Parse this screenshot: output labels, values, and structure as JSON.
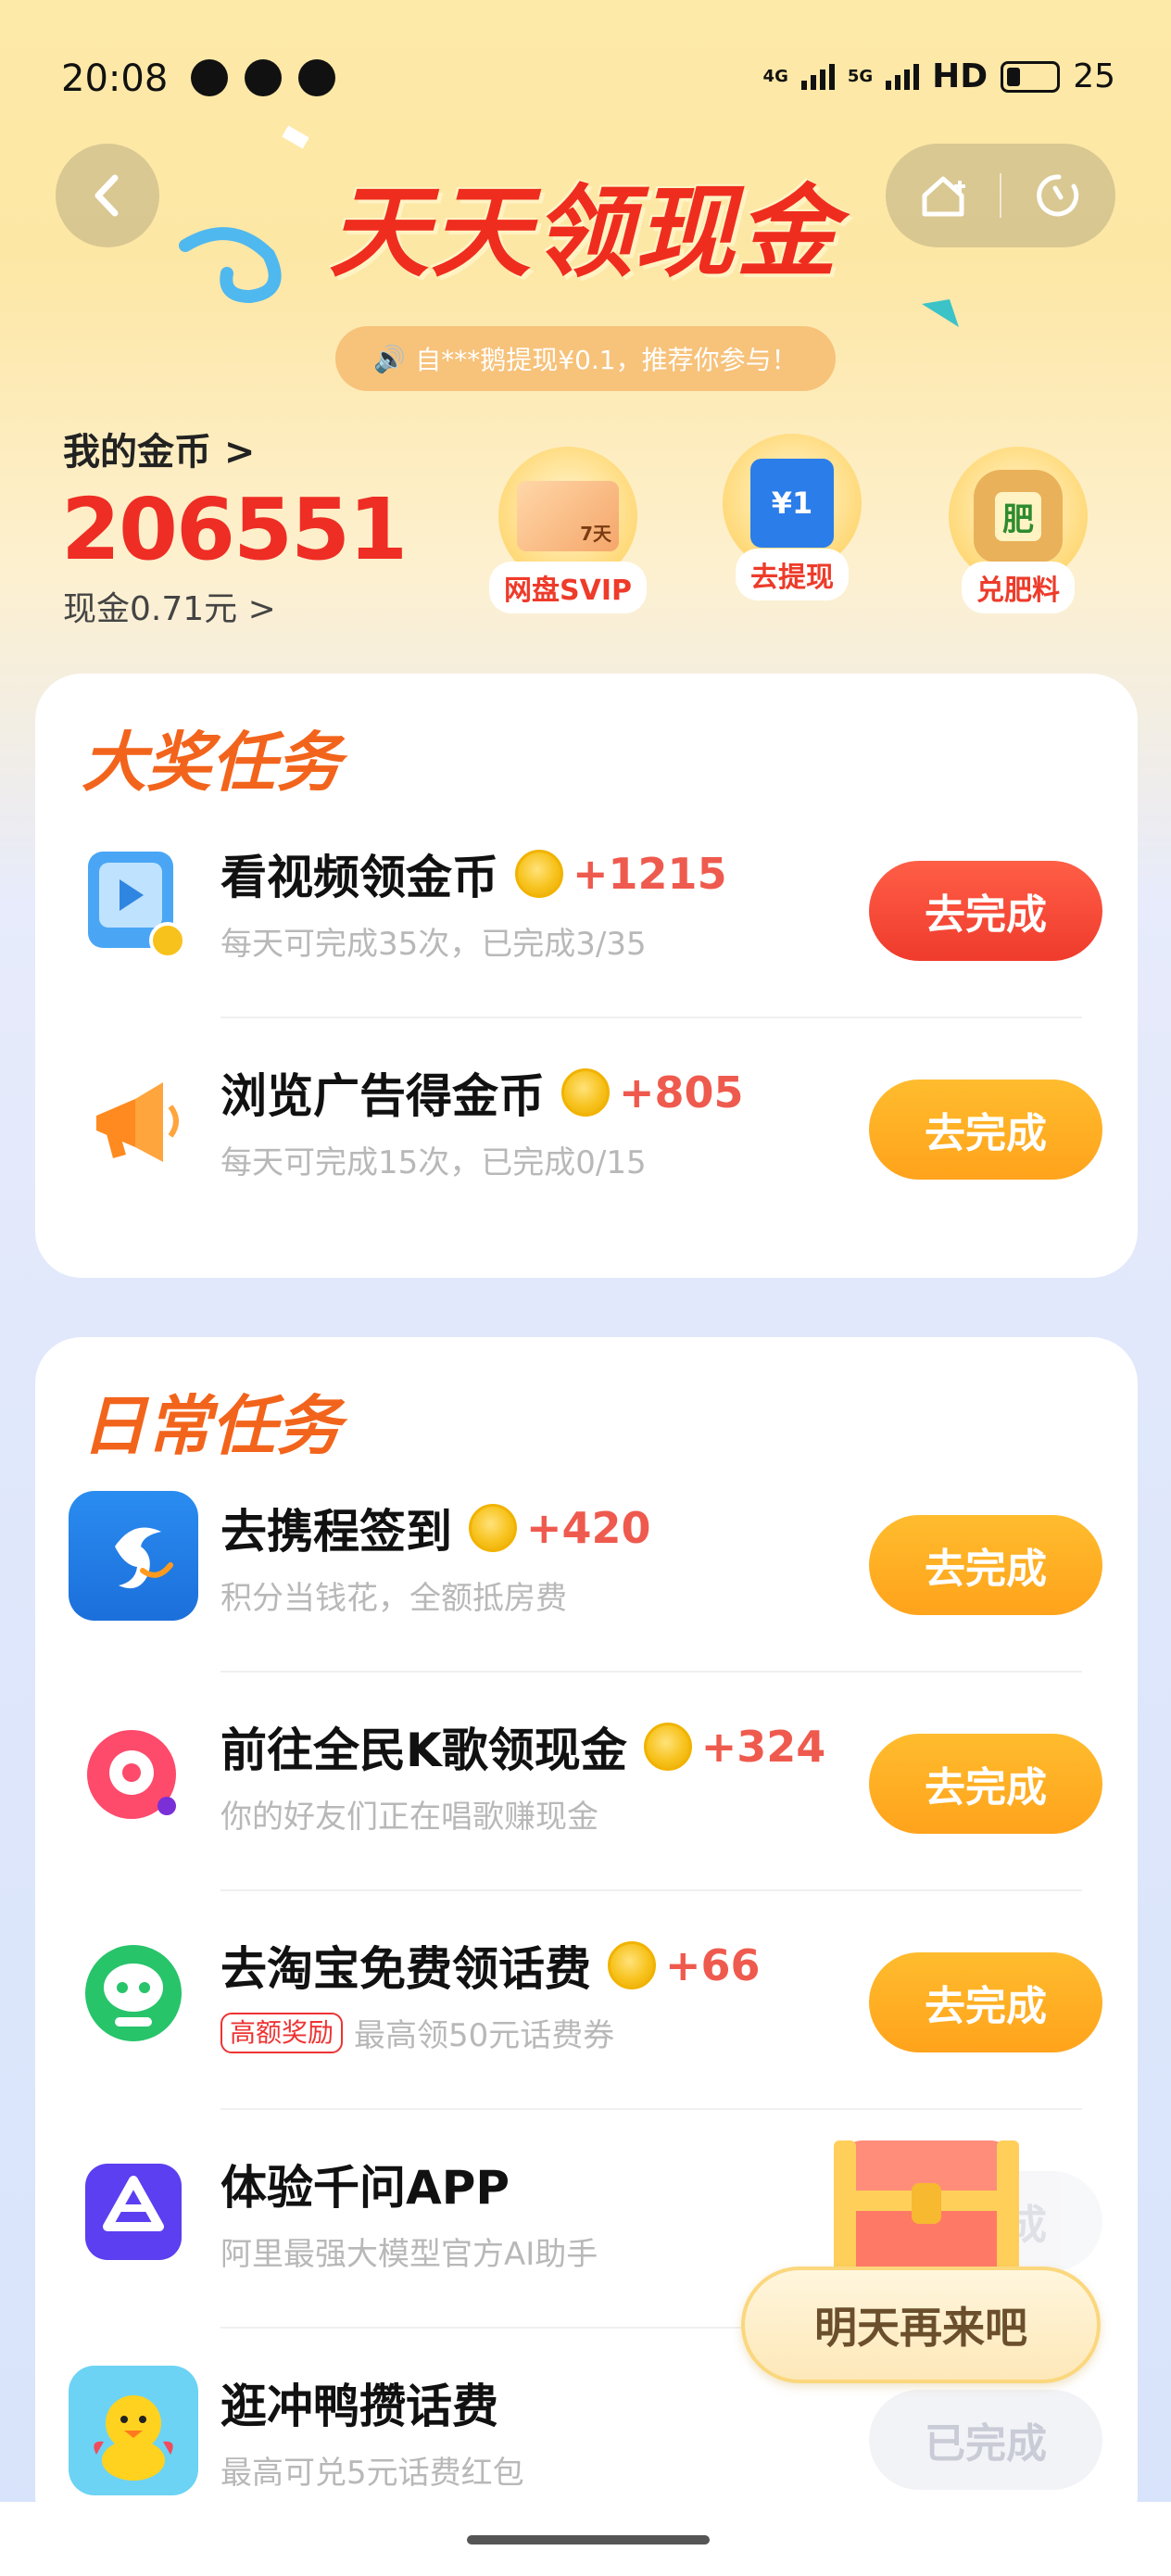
{
  "status_bar": {
    "time": "20:08",
    "network1": "4G",
    "network2": "5G",
    "hd": "HD",
    "battery": "25"
  },
  "header": {
    "title": "天天领现金",
    "notice": "自***鹅提现¥0.1，推荐你参与！"
  },
  "wallet": {
    "coins_label": "我的金币 >",
    "coins_value": "206551",
    "cash_label": "现金0.71元 >"
  },
  "shortcuts": [
    {
      "label": "网盘SVIP",
      "badge": "7天"
    },
    {
      "label": "去提现",
      "badge": "¥1"
    },
    {
      "label": "兑肥料",
      "badge": "肥"
    }
  ],
  "big_tasks": {
    "title": "大奖任务",
    "items": [
      {
        "name": "看视频领金币",
        "reward": "+1215",
        "desc": "每天可完成35次，已完成3/35",
        "button": "去完成"
      },
      {
        "name": "浏览广告得金币",
        "reward": "+805",
        "desc": "每天可完成15次，已完成0/15",
        "button": "去完成"
      }
    ]
  },
  "daily_tasks": {
    "title": "日常任务",
    "items": [
      {
        "name": "去携程签到",
        "reward": "+420",
        "desc": "积分当钱花，全额抵房费",
        "button": "去完成"
      },
      {
        "name": "前往全民K歌领现金",
        "reward": "+324",
        "desc": "你的好友们正在唱歌赚现金",
        "button": "去完成"
      },
      {
        "name": "去淘宝免费领话费",
        "reward": "+66",
        "badge": "高额奖励",
        "desc": "最高领50元话费券",
        "button": "去完成"
      },
      {
        "name": "体验千问APP",
        "desc": "阿里最强大模型官方AI助手",
        "button": "去完成"
      },
      {
        "name": "逛冲鸭攒话费",
        "desc": "最高可兑5元话费红包",
        "button": "已完成"
      }
    ]
  },
  "floating": {
    "label": "明天再来吧"
  },
  "colors": {
    "accent_red": "#ee2d24",
    "accent_orange": "#ffa31b",
    "section_title": "#f2641c"
  }
}
